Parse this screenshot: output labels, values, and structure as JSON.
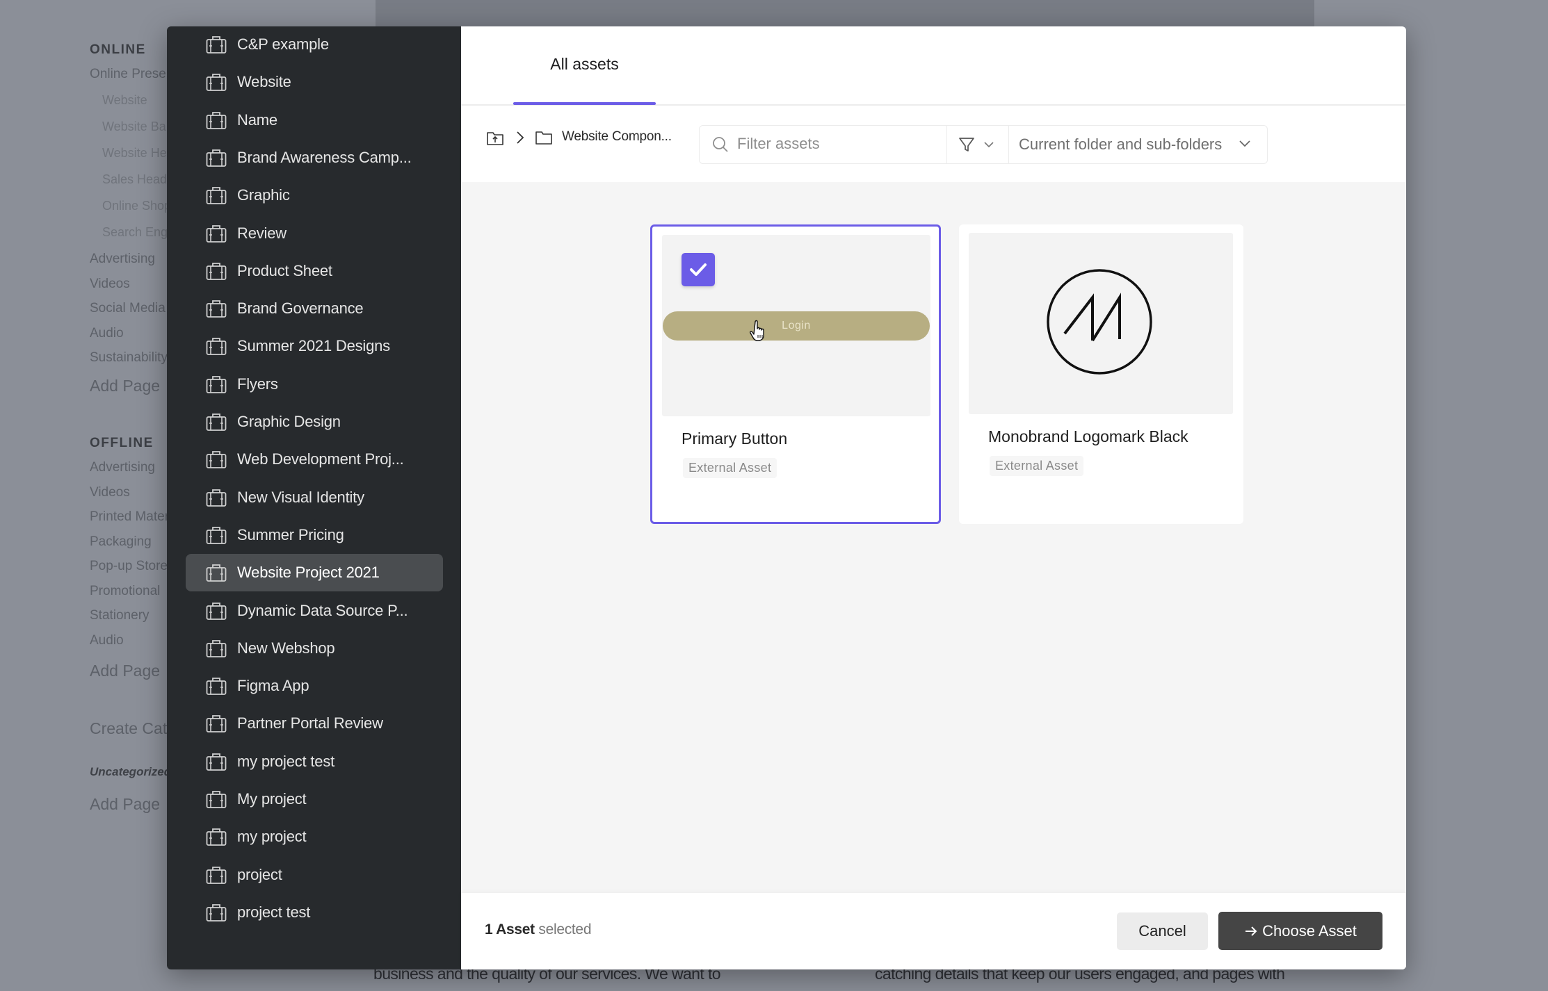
{
  "background_page": {
    "nav": {
      "online_heading": "ONLINE",
      "online_items": [
        {
          "label": "Online Presence",
          "level": 0
        },
        {
          "label": "Website",
          "level": 1
        },
        {
          "label": "Website Banners",
          "level": 1
        },
        {
          "label": "Website Headers",
          "level": 1
        },
        {
          "label": "Sales Headers",
          "level": 1
        },
        {
          "label": "Online Shop",
          "level": 1
        },
        {
          "label": "Search Engine",
          "level": 1
        },
        {
          "label": "Advertising",
          "level": 0
        },
        {
          "label": "Videos",
          "level": 0
        },
        {
          "label": "Social Media",
          "level": 0
        },
        {
          "label": "Audio",
          "level": 0
        },
        {
          "label": "Sustainability",
          "level": 0
        }
      ],
      "online_add_page": "Add Page",
      "offline_heading": "OFFLINE",
      "offline_items": [
        "Advertising",
        "Videos",
        "Printed Material",
        "Packaging",
        "Pop-up Store",
        "Promotional",
        "Stationery",
        "Audio"
      ],
      "offline_add_page": "Add Page",
      "create_category": "Create Category",
      "uncategorized_heading": "Uncategorized",
      "uncategorized_add_page": "Add Page"
    },
    "bottom_text_left": "business and the quality of our services. We want to",
    "bottom_text_right": "catching details that keep our users engaged, and pages with"
  },
  "dialog": {
    "projects": [
      {
        "label": "C&P example",
        "icon": "briefcase-icon"
      },
      {
        "label": "Website",
        "icon": "briefcase-icon"
      },
      {
        "label": "Name",
        "icon": "briefcase-icon"
      },
      {
        "label": "Brand Awareness Camp...",
        "icon": "briefcase-icon"
      },
      {
        "label": "Graphic",
        "icon": "briefcase-icon"
      },
      {
        "label": "Review",
        "icon": "briefcase-icon"
      },
      {
        "label": "Product Sheet",
        "icon": "briefcase-icon"
      },
      {
        "label": "Brand Governance",
        "icon": "briefcase-icon"
      },
      {
        "label": "Summer 2021 Designs",
        "icon": "briefcase-icon"
      },
      {
        "label": "Flyers",
        "icon": "briefcase-icon"
      },
      {
        "label": "Graphic Design",
        "icon": "briefcase-icon"
      },
      {
        "label": "Web Development Proj...",
        "icon": "briefcase-icon"
      },
      {
        "label": "New Visual Identity",
        "icon": "briefcase-icon"
      },
      {
        "label": "Summer Pricing",
        "icon": "briefcase-icon"
      },
      {
        "label": "Website Project 2021",
        "icon": "briefcase-icon",
        "selected": true
      },
      {
        "label": "Dynamic Data Source P...",
        "icon": "briefcase-icon"
      },
      {
        "label": "New Webshop",
        "icon": "briefcase-icon"
      },
      {
        "label": "Figma App",
        "icon": "briefcase-icon"
      },
      {
        "label": "Partner Portal Review",
        "icon": "briefcase-icon"
      },
      {
        "label": "my project test",
        "icon": "briefcase-icon"
      },
      {
        "label": "My project",
        "icon": "briefcase-icon"
      },
      {
        "label": "my project",
        "icon": "briefcase-icon"
      },
      {
        "label": "project",
        "icon": "briefcase-icon"
      },
      {
        "label": "project test",
        "icon": "briefcase-icon"
      }
    ],
    "tabs": [
      {
        "label": "All assets",
        "active": true
      }
    ],
    "toolbar": {
      "breadcrumb_up_icon": "folder-up-icon",
      "breadcrumb_separator_icon": "chevron-right-icon",
      "breadcrumb_folder_icon": "folder-icon",
      "breadcrumb_current": "Website Compon...",
      "filter_placeholder": "Filter assets",
      "filter_value": "",
      "filter_icon": "funnel-icon",
      "scope_selected": "Current folder and sub-folders"
    },
    "assets": [
      {
        "name": "Primary Button",
        "badge": "External Asset",
        "selected": true,
        "preview": {
          "type": "button",
          "text": "Login"
        }
      },
      {
        "name": "Monobrand Logomark Black",
        "badge": "External Asset",
        "selected": false,
        "preview": {
          "type": "logo",
          "icon": "monobrand-logomark-icon"
        }
      }
    ],
    "footer": {
      "selected_count": "1 Asset",
      "selected_suffix": " selected",
      "cancel_label": "Cancel",
      "choose_label": "Choose Asset",
      "choose_icon": "arrow-right-icon"
    }
  },
  "colors": {
    "accent": "#6b5ce7",
    "sidebar_bg": "#272a2d",
    "sidebar_selected_bg": "#4a4d50",
    "primary_button_bg": "#454545",
    "login_preview_bg": "#b7ae82",
    "content_bg": "#f5f5f5",
    "overlay_bg": "#8b8f98"
  }
}
